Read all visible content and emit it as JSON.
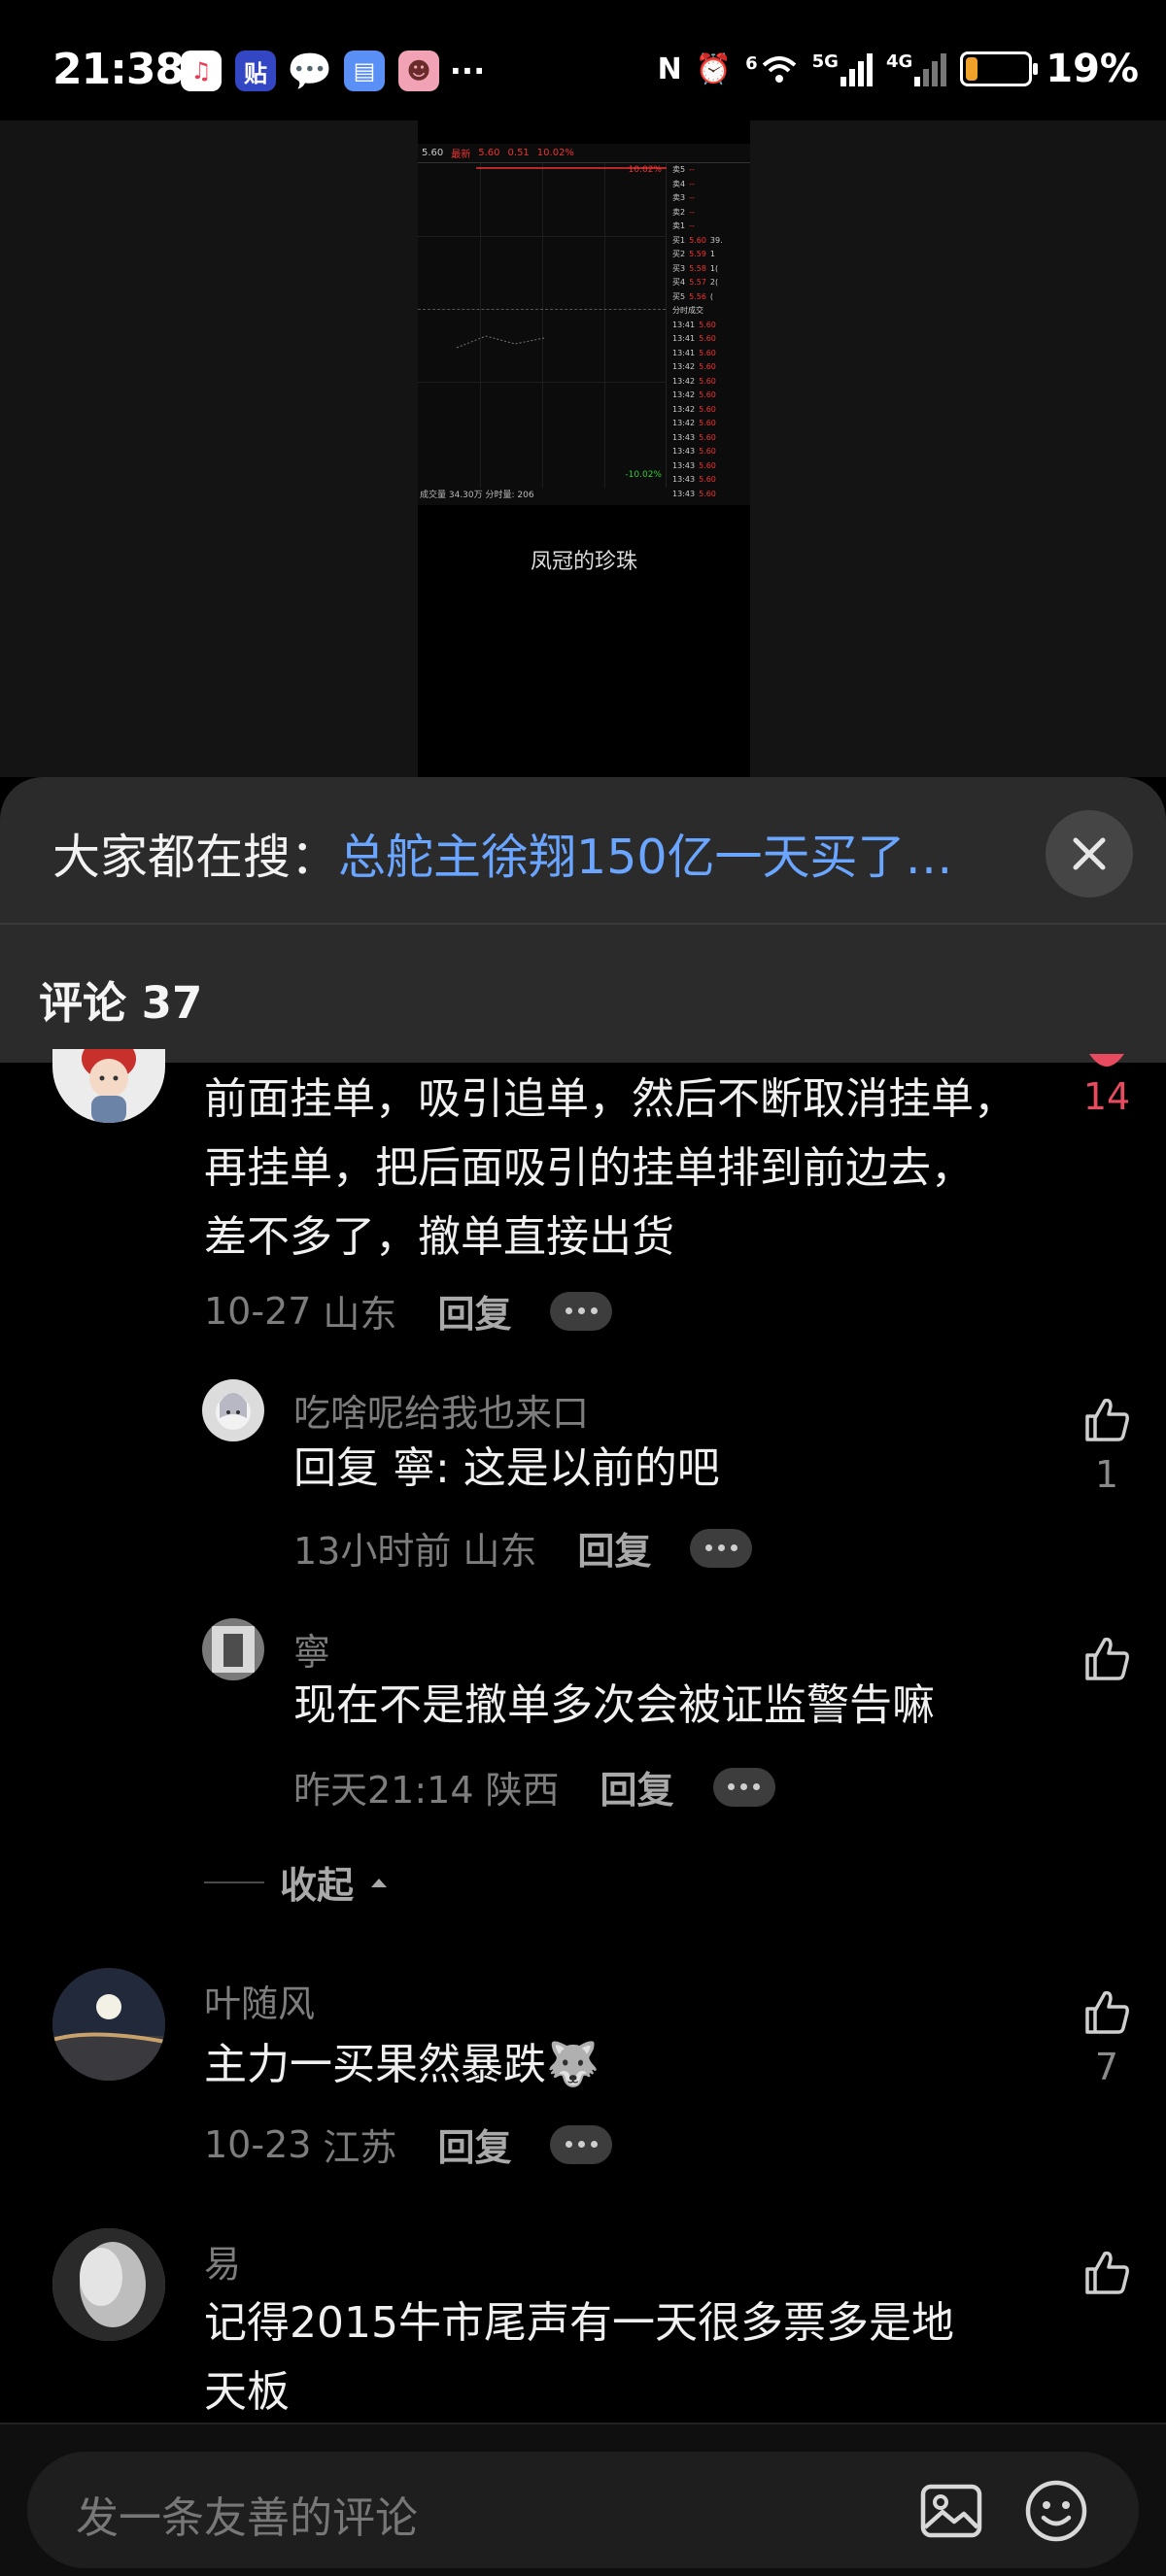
{
  "status_bar": {
    "time": "21:38",
    "notification_icons": [
      "music-icon",
      "tie-icon",
      "chat-icon",
      "doc-icon",
      "face-icon",
      "more-icon"
    ],
    "music_glyph": "♫",
    "tie_glyph": "贴",
    "chat_glyph": "💬",
    "doc_glyph": "▤",
    "face_glyph": "☻",
    "more_glyph": "···",
    "nfc_glyph": "N",
    "alarm_glyph": "⏰",
    "wifi_label": "6",
    "signal_5g": "5G",
    "signal_4g": "4G",
    "battery_percent": 0.19,
    "battery_text": "19%",
    "battery_color": "#f0a12a"
  },
  "video": {
    "caption": "凤冠的珍珠",
    "stock_header": [
      "5.60",
      "最新",
      "5.60",
      "0.51",
      "10.02%"
    ],
    "pct_top": "10.02%",
    "pct_bottom": "-10.02%",
    "volume_label": "成交量 34.30万 分时量: 206",
    "sell_rows": [
      {
        "label": "卖5",
        "price": "--"
      },
      {
        "label": "卖4",
        "price": "--"
      },
      {
        "label": "卖3",
        "price": "--"
      },
      {
        "label": "卖2",
        "price": "--"
      },
      {
        "label": "卖1",
        "price": "--"
      }
    ],
    "buy_rows": [
      {
        "label": "买1",
        "price": "5.60",
        "vol": "39."
      },
      {
        "label": "买2",
        "price": "5.59",
        "vol": "1"
      },
      {
        "label": "买3",
        "price": "5.58",
        "vol": "1("
      },
      {
        "label": "买4",
        "price": "5.57",
        "vol": "2("
      },
      {
        "label": "买5",
        "price": "5.56",
        "vol": "("
      }
    ],
    "tick_title": "分时成交",
    "ticks": [
      {
        "t": "13:41",
        "p": "5.60"
      },
      {
        "t": "13:41",
        "p": "5.60"
      },
      {
        "t": "13:41",
        "p": "5.60"
      },
      {
        "t": "13:42",
        "p": "5.60"
      },
      {
        "t": "13:42",
        "p": "5.60"
      },
      {
        "t": "13:42",
        "p": "5.60"
      },
      {
        "t": "13:42",
        "p": "5.60"
      },
      {
        "t": "13:42",
        "p": "5.60"
      },
      {
        "t": "13:43",
        "p": "5.60"
      },
      {
        "t": "13:43",
        "p": "5.60"
      },
      {
        "t": "13:43",
        "p": "5.60"
      },
      {
        "t": "13:43",
        "p": "5.60"
      },
      {
        "t": "13:43",
        "p": "5.60"
      }
    ]
  },
  "search_banner": {
    "prefix": "大家都在搜：",
    "query": "总舵主徐翔150亿一天买了…"
  },
  "comments_header": "评论 37",
  "comments": [
    {
      "author": "",
      "text_lines": [
        "前面挂单，吸引追单，然后不断取消挂单，",
        "再挂单，把后面吸引的挂单排到前边去，",
        "差不多了，撤单直接出货"
      ],
      "date": "10-27",
      "location": "山东",
      "reply_label": "回复",
      "likes": "14",
      "liked": true
    },
    {
      "author": "吃啥呢给我也来口",
      "text_lines": [
        "回复 寧: 这是以前的吧"
      ],
      "date": "13小时前",
      "location": "山东",
      "reply_label": "回复",
      "likes": "1",
      "liked": false
    },
    {
      "author": "寧",
      "text_lines": [
        "现在不是撤单多次会被证监警告嘛"
      ],
      "date": "昨天21:14",
      "location": "陕西",
      "reply_label": "回复",
      "likes": "",
      "liked": false
    },
    {
      "author": "叶随风",
      "text_lines": [
        "主力一买果然暴跌🐺"
      ],
      "date": "10-23",
      "location": "江苏",
      "reply_label": "回复",
      "likes": "7",
      "liked": false
    },
    {
      "author": "易",
      "text_lines": [
        "记得2015牛市尾声有一天很多票多是地",
        "天板"
      ],
      "date": "",
      "location": "",
      "reply_label": "",
      "likes": "",
      "liked": false
    }
  ],
  "collapse_label": "收起",
  "input": {
    "placeholder": "发一条友善的评论"
  },
  "colors": {
    "accent_link": "#6aa5ff",
    "like_red": "#e84a5f",
    "sheet_bg": "#2b2b2b"
  }
}
